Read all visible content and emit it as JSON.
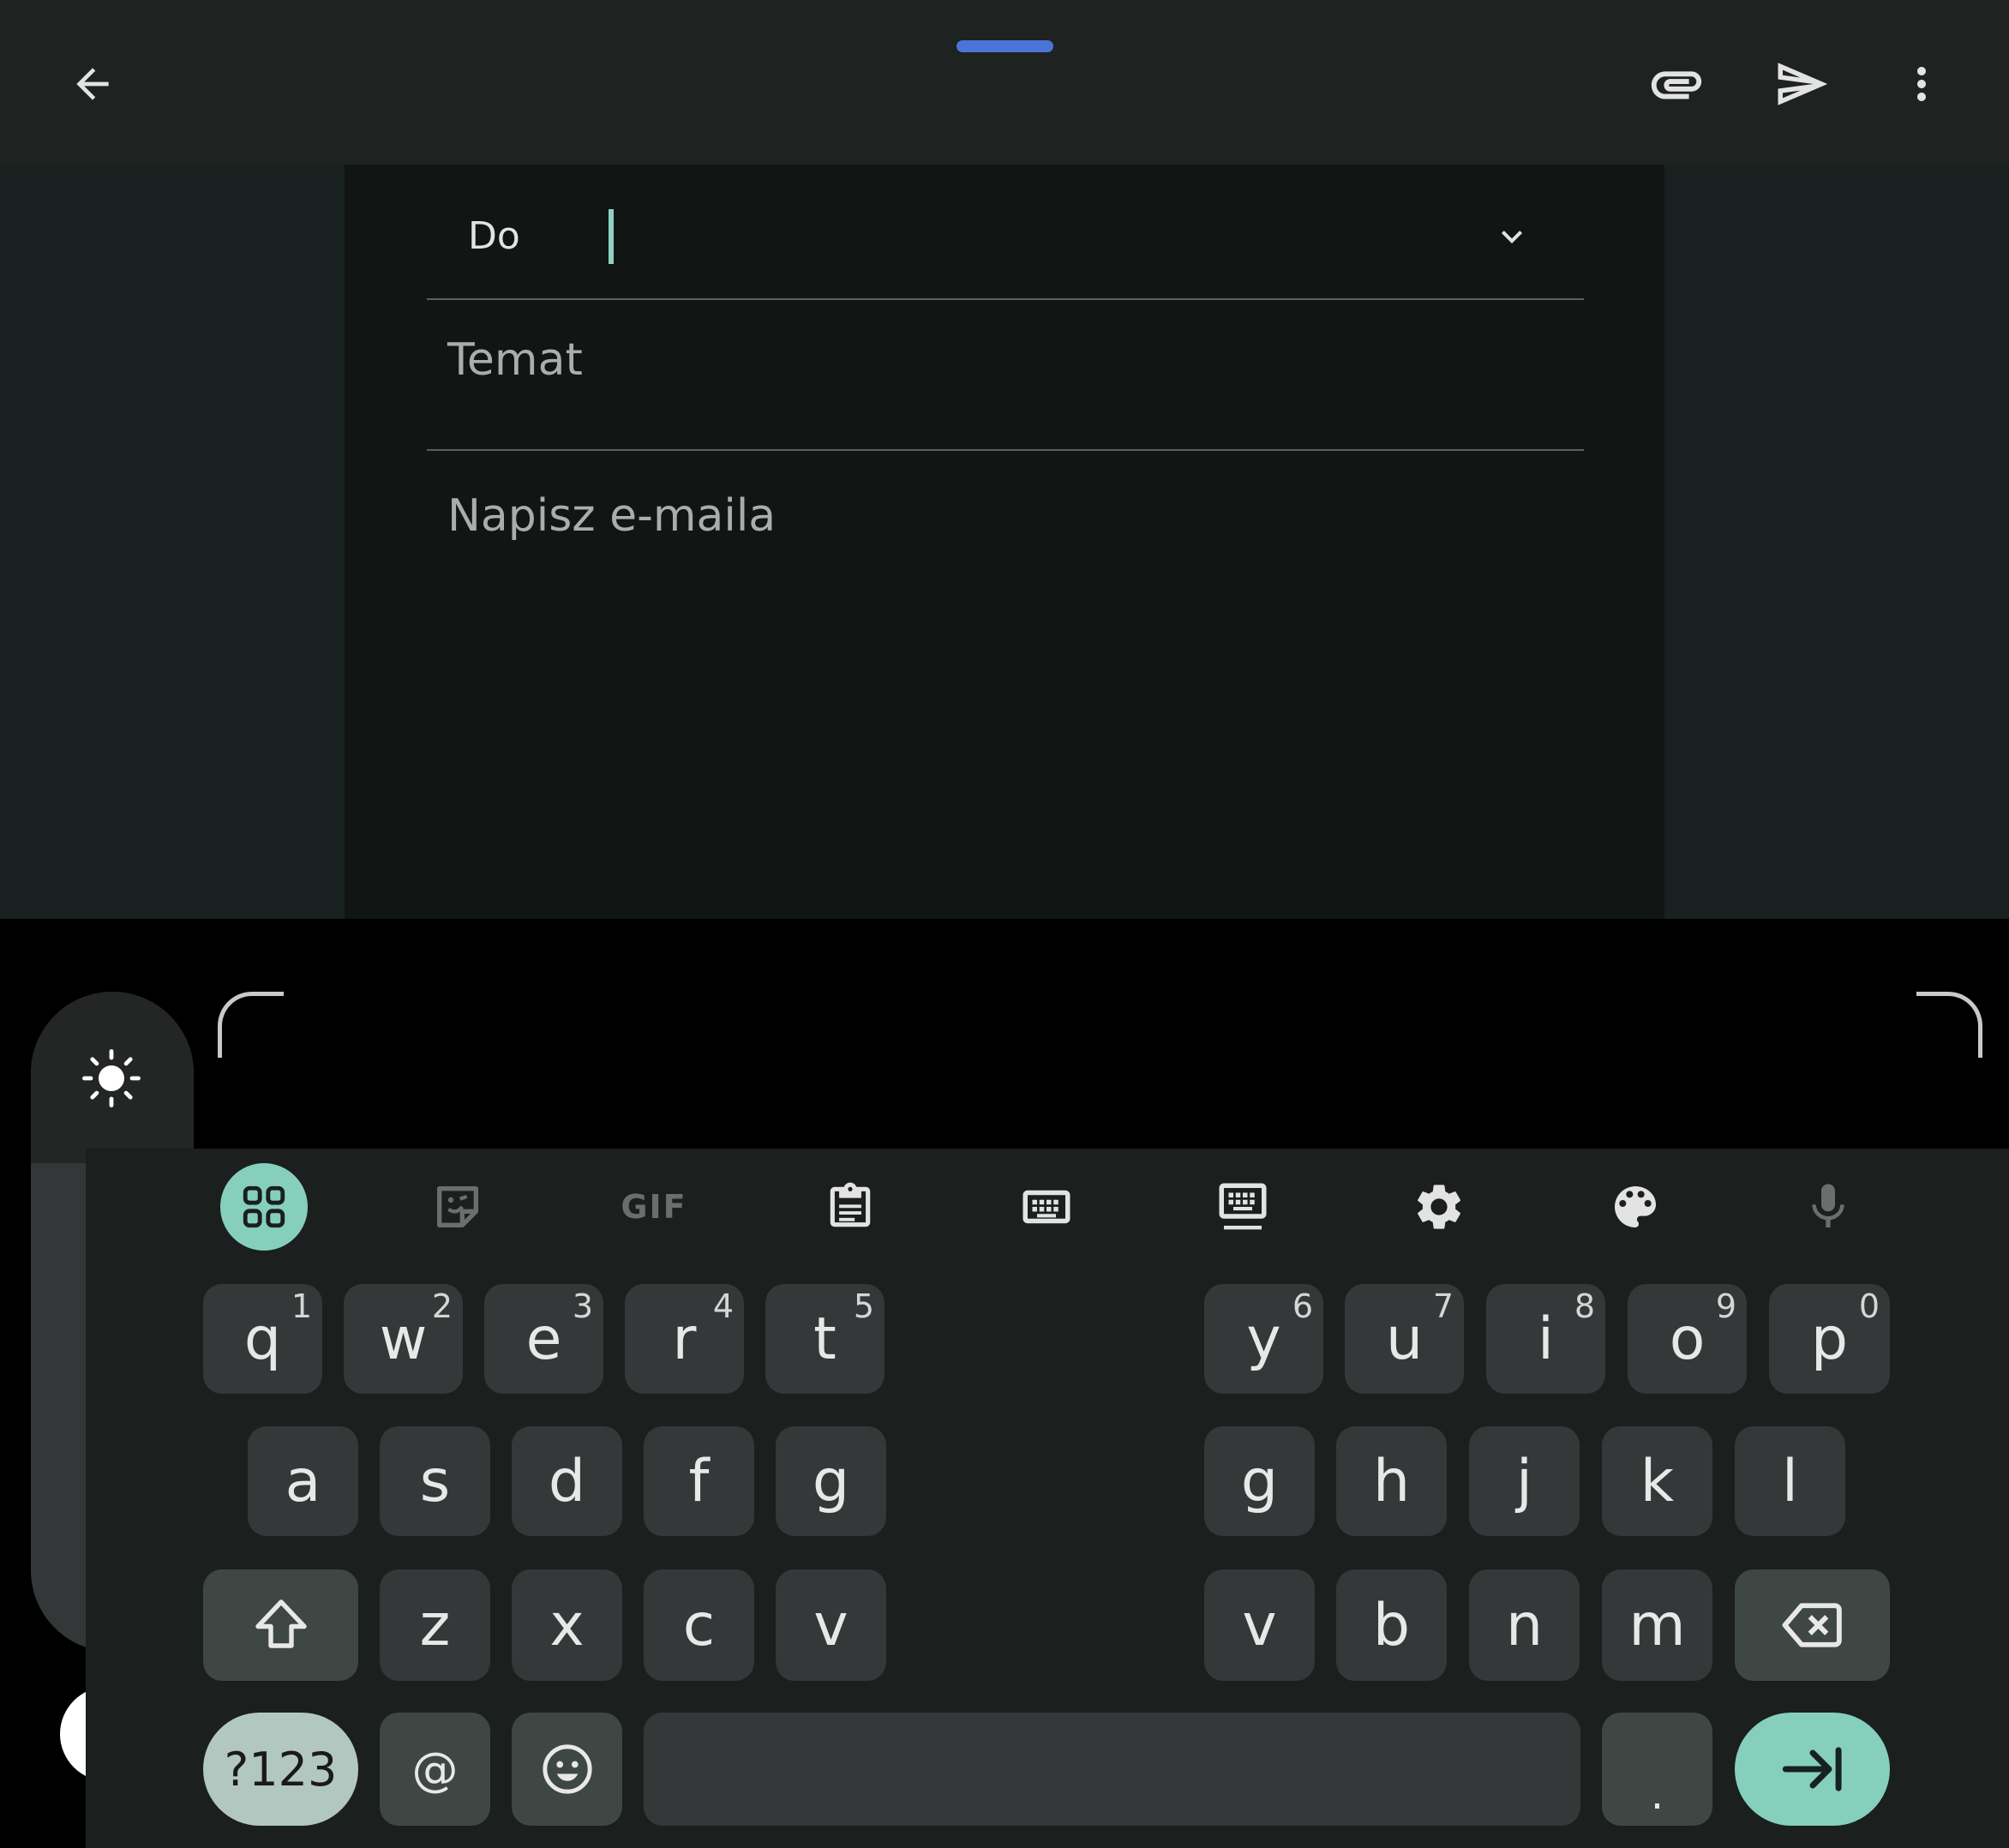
{
  "topbar": {
    "back_icon": "arrow-left-icon",
    "attach_icon": "paperclip-icon",
    "send_icon": "send-icon",
    "more_icon": "more-vert-icon"
  },
  "compose": {
    "to_label": "Do",
    "subject_placeholder": "Temat",
    "body_placeholder": "Napisz e-maila"
  },
  "keyboard": {
    "toolbar": {
      "gif_label": "GIF"
    },
    "rows": [
      [
        {
          "key": "q",
          "hint": "1"
        },
        {
          "key": "w",
          "hint": "2"
        },
        {
          "key": "e",
          "hint": "3"
        },
        {
          "key": "r",
          "hint": "4"
        },
        {
          "key": "t",
          "hint": "5"
        },
        {
          "key": "y",
          "hint": "6"
        },
        {
          "key": "u",
          "hint": "7"
        },
        {
          "key": "i",
          "hint": "8"
        },
        {
          "key": "o",
          "hint": "9"
        },
        {
          "key": "p",
          "hint": "0"
        }
      ],
      [
        {
          "key": "a"
        },
        {
          "key": "s"
        },
        {
          "key": "d"
        },
        {
          "key": "f"
        },
        {
          "key": "g"
        },
        {
          "key": "g"
        },
        {
          "key": "h"
        },
        {
          "key": "j"
        },
        {
          "key": "k"
        },
        {
          "key": "l"
        }
      ],
      [
        {
          "key": "z"
        },
        {
          "key": "x"
        },
        {
          "key": "c"
        },
        {
          "key": "v"
        },
        {
          "key": "v"
        },
        {
          "key": "b"
        },
        {
          "key": "n"
        },
        {
          "key": "m"
        }
      ]
    ],
    "symbols_label": "?123",
    "at_label": "@",
    "period_label": "."
  }
}
